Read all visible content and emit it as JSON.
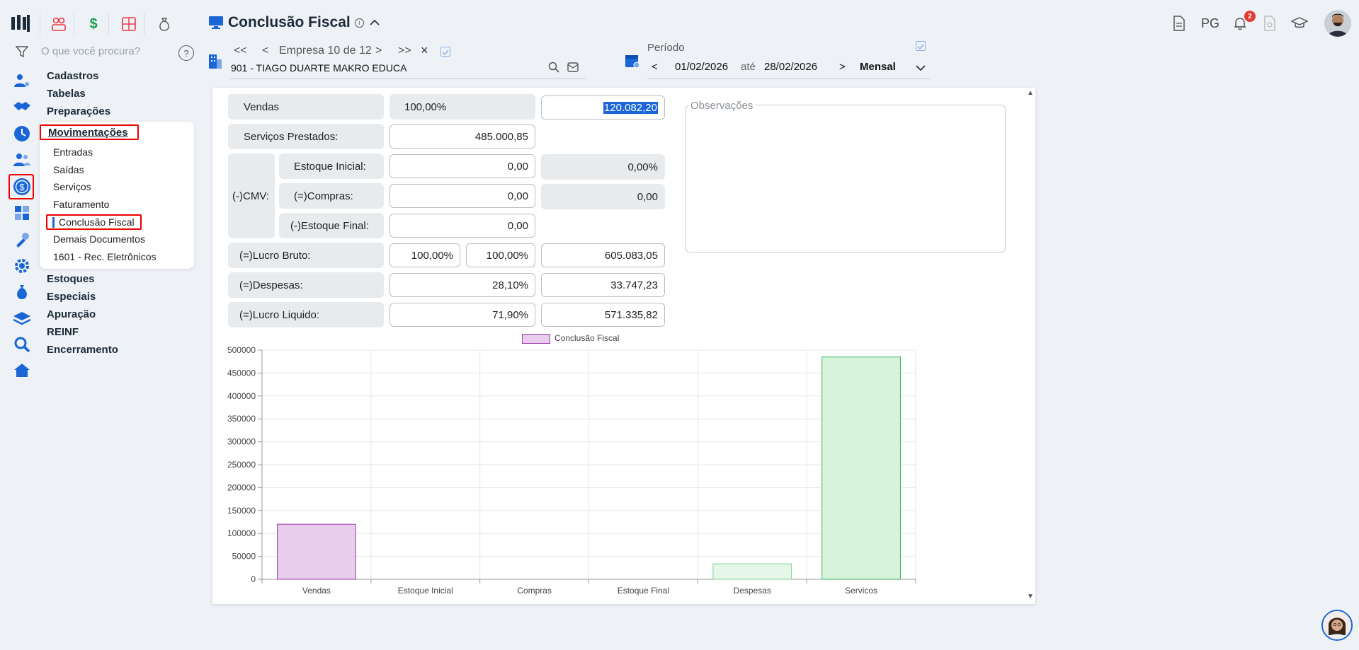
{
  "app": {
    "title": "Conclusão Fiscal",
    "top_text_icon": "PG",
    "notification_count": "2",
    "colors": {
      "accent": "#1a66d6",
      "highlight": "#e00000",
      "vendas_bar": "#e8cdec",
      "servicos_bar": "#d8f3dc"
    }
  },
  "sidebar": {
    "search_placeholder": "O que você procura?",
    "help": "?",
    "menu_top": [
      "Cadastros",
      "Tabelas",
      "Preparações",
      "Movimentações"
    ],
    "submenu": [
      "Entradas",
      "Saídas",
      "Serviços",
      "Faturamento",
      "Conclusão Fiscal",
      "Demais Documentos",
      "1601 - Rec. Eletrônicos"
    ],
    "menu_bottom": [
      "Estoques",
      "Especiais",
      "Apuração",
      "REINF",
      "Encerramento"
    ]
  },
  "company_nav": {
    "first": "<<",
    "prev": "<",
    "label": "Empresa 10 de 12",
    "next": ">",
    "last": ">>",
    "close": "×",
    "company": "901 - TIAGO DUARTE MAKRO EDUCA"
  },
  "period": {
    "label": "Período",
    "prev": "<",
    "start": "01/02/2026",
    "until": "até",
    "end": "28/02/2026",
    "next": ">",
    "mode": "Mensal"
  },
  "form": {
    "vendas_label": "Vendas",
    "vendas_pct": "100,00%",
    "vendas_value": "120.082,20",
    "servicos_label": "Serviços Prestados:",
    "servicos_value": "485.000,85",
    "cmv_label": "(-)CMV:",
    "estoque_inicial_label": "Estoque Inicial:",
    "estoque_inicial_value": "0,00",
    "estoque_inicial_pct": "0,00%",
    "compras_label": "(=)Compras:",
    "compras_value": "0,00",
    "compras_ro": "0,00",
    "estoque_final_label": "(-)Estoque Final:",
    "estoque_final_value": "0,00",
    "lucro_bruto_label": "(=)Lucro Bruto:",
    "lucro_bruto_pct1": "100,00%",
    "lucro_bruto_pct2": "100,00%",
    "lucro_bruto_value": "605.083,05",
    "despesas_label": "(=)Despesas:",
    "despesas_pct": "28,10%",
    "despesas_value": "33.747,23",
    "lucro_liquido_label": "(=)Lucro Liquido:",
    "lucro_liquido_pct": "71,90%",
    "lucro_liquido_value": "571.335,82",
    "observacoes_label": "Observações"
  },
  "chart_data": {
    "type": "bar",
    "legend": "Conclusão Fiscal",
    "categories": [
      "Vendas",
      "Estoque Inicial",
      "Compras",
      "Estoque Final",
      "Despesas",
      "Servicos"
    ],
    "values": [
      120082.2,
      0,
      0,
      0,
      33747.23,
      485000.85
    ],
    "ylim": [
      0,
      500000
    ],
    "yticks": [
      0,
      50000,
      100000,
      150000,
      200000,
      250000,
      300000,
      350000,
      400000,
      450000,
      500000
    ],
    "grid": true,
    "legend_position": "top-center"
  }
}
